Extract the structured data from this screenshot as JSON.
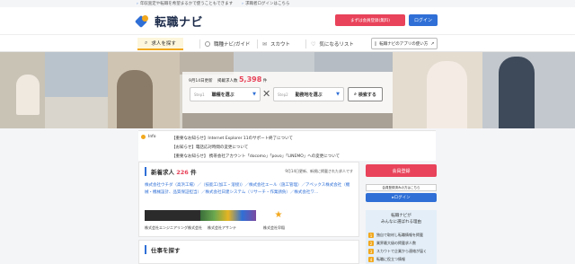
{
  "top_notes": [
    "年収査定や転職を希望まるかで使うこともできます",
    "求職者ログインはこちら"
  ],
  "header": {
    "logo_text": "転職ナビ",
    "register_label": "まずは会員登録(無料)",
    "login_label": "ログイン"
  },
  "nav": {
    "items": [
      "求人を探す",
      "職種ナビ/ガイド",
      "スカウト",
      "気になるリスト"
    ],
    "app_button": "転職ナビのアプリの使い方"
  },
  "hero": {
    "date_text": "9月14日更新",
    "count_label": "掲載求人数",
    "count_value": "5,398",
    "count_unit": "件",
    "select_job_placeholder": "Step1",
    "select_job_label": "職種を選ぶ",
    "select_area_placeholder": "Step2",
    "select_area_label": "勤務地を選ぶ",
    "search_button": "検索する"
  },
  "info": {
    "badge": "Info",
    "items": [
      "【重要なお知らせ】Internet Explorer 11のサポート終了について",
      "【お知らせ】電話応対時間の変更について",
      "【重要なお知らせ】 携帯会社アカウント「docomo」「povo」「LINEMO」への変更について"
    ]
  },
  "new_jobs": {
    "title": "新着求人",
    "count": "226",
    "count_unit": "件",
    "note": "9月14日更新、新規に掲載された求人です",
    "companies_text": "株式会社ウチダ（高浜工場）／（技能工(加工・溶接)）／株式会社エール（施工管理）／アペックス株式会社（機械・機械設計、品質保証担当）／株式会社日建システム（リサーチ・作業請負）／株式会社ワ…",
    "logo_captions": [
      "株式会社エンジニアリング株式会社",
      "株式会社アサンテ",
      "株式会社早稲"
    ]
  },
  "job_search": {
    "title": "仕事を探す"
  },
  "sidebar": {
    "register_label": "会員登録",
    "member_input": "会員登録済みの方はこちら",
    "login_label": "ログイン",
    "box_title_1": "転職ナビが",
    "box_title_2": "みんなに選ばれる理由",
    "reasons": [
      {
        "num": "1",
        "text": "独自で取材し転職情報を掲載"
      },
      {
        "num": "2",
        "text": "業界最大級の掲載求人数"
      },
      {
        "num": "3",
        "text": "スカウトで企業から連絡が届く"
      },
      {
        "num": "4",
        "text": "転職に役立つ情報"
      }
    ]
  },
  "colors": {
    "brand_blue": "#2f6fd6",
    "accent_red": "#e8435a",
    "accent_orange": "#f2a81d"
  }
}
